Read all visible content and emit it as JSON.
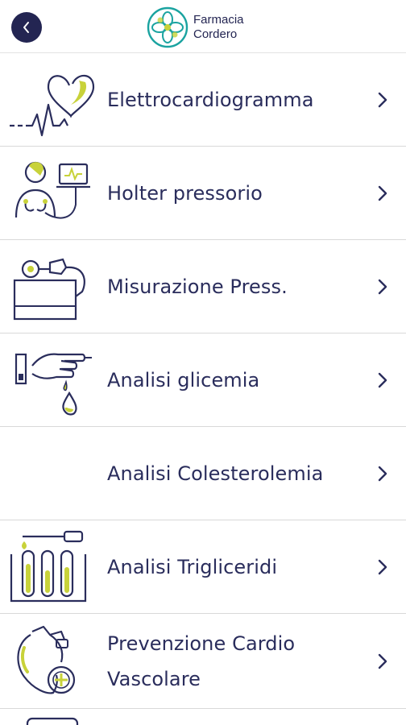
{
  "header": {
    "brand_line1": "Farmacia",
    "brand_line2": "Cordero",
    "back_icon": "chevron-left-icon"
  },
  "colors": {
    "navy": "#232552",
    "lime": "#c8d23a",
    "teal": "#1aa3a0",
    "divider": "#d9d9d9"
  },
  "services": [
    {
      "label": "Elettrocardiogramma",
      "icon": "ecg-heart-icon"
    },
    {
      "label": "Holter pressorio",
      "icon": "holter-monitor-icon"
    },
    {
      "label": "Misurazione Press.",
      "icon": "blood-pressure-cuff-icon"
    },
    {
      "label": "Analisi glicemia",
      "icon": "finger-blood-drop-icon"
    },
    {
      "label": "Analisi Colesterolemia",
      "icon": ""
    },
    {
      "label": "Analisi Trigliceridi",
      "icon": "test-tubes-icon"
    },
    {
      "label_line1": "Prevenzione Cardio",
      "label_line2": "Vascolare",
      "icon": "heart-stethoscope-icon"
    }
  ]
}
